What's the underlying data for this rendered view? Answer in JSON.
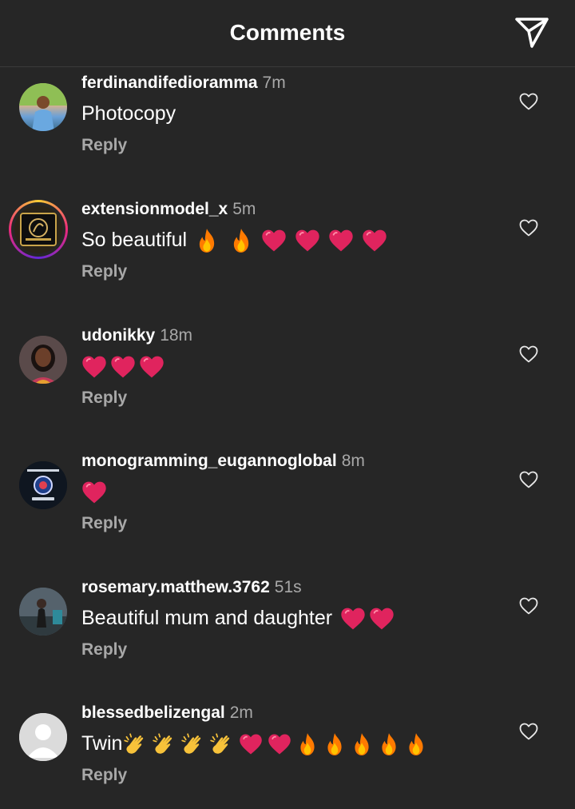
{
  "header": {
    "title": "Comments",
    "send_icon": "send-icon"
  },
  "comments": [
    {
      "username": "ferdinandifedioramma",
      "time": "7m",
      "text": "Photocopy",
      "reply": "Reply",
      "avatar": "photo-avatar"
    },
    {
      "username": "extensionmodel_x",
      "time": "5m",
      "text": "So beautiful",
      "reply": "Reply",
      "avatar": "brand-logo-avatar",
      "story_ring": true
    },
    {
      "username": "udonikky",
      "time": "18m",
      "text": "",
      "reply": "Reply",
      "avatar": "photo-avatar"
    },
    {
      "username": "monogramming_eugannoglobal",
      "time": "8m",
      "text": "",
      "reply": "Reply",
      "avatar": "brand-logo-avatar"
    },
    {
      "username": "rosemary.matthew.3762",
      "time": "51s",
      "text": "Beautiful mum and daughter",
      "reply": "Reply",
      "avatar": "photo-avatar"
    },
    {
      "username": "blessedbelizengal",
      "time": "2m",
      "text": "Twin",
      "reply": "Reply",
      "avatar": "default-avatar"
    }
  ],
  "colors": {
    "background": "#262626",
    "text": "#ffffff",
    "muted": "#a8a8a8",
    "heart": "#e0245e",
    "fire": "#ff8a00"
  }
}
